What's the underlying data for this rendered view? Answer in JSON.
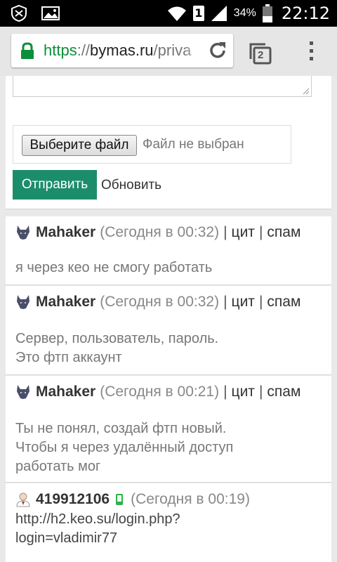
{
  "status_bar": {
    "sim_slot": "1",
    "battery_percent": "34%",
    "time": "22:12"
  },
  "browser": {
    "url_scheme": "https",
    "url_separator": "://",
    "url_host": "bymas.ru",
    "url_path": "/priva",
    "tab_count": "2"
  },
  "form": {
    "choose_file_label": "Выберите файл",
    "no_file_text": "Файл не выбран",
    "send_label": "Отправить",
    "refresh_label": "Обновить"
  },
  "posts": [
    {
      "author": "Mahaker",
      "date": "(Сегодня в 00:32)",
      "sep": "|",
      "quote": "цит",
      "spam": "спам",
      "lines": [
        "я через кео не смогу работать"
      ]
    },
    {
      "author": "Mahaker",
      "date": "(Сегодня в 00:32)",
      "sep": "|",
      "quote": "цит",
      "spam": "спам",
      "lines": [
        "Сервер, пользователь, пароль.",
        "Это фтп аккаунт"
      ]
    },
    {
      "author": "Mahaker",
      "date": "(Сегодня в 00:21)",
      "sep": "|",
      "quote": "цит",
      "spam": "спам",
      "lines": [
        "Ты не понял, создай фтп новый.",
        "Чтобы я через удалённый доступ",
        "работать мог"
      ]
    },
    {
      "author": "419912106",
      "date": "(Сегодня в 00:19)",
      "lines": [
        "http://h2.keo.su/login.php?",
        "login=vladimir77"
      ]
    }
  ],
  "colors": {
    "send_button": "#1c8d6a",
    "https_green": "#0b8f3a",
    "online_phone": "#2db34a"
  },
  "icons": [
    "shield-icon",
    "image-icon",
    "wifi-icon",
    "signal-icon",
    "battery-icon",
    "lock-icon",
    "reload-icon",
    "tabs-icon",
    "overflow-menu-icon",
    "wolf-avatar-icon",
    "user-avatar-icon",
    "mobile-phone-icon"
  ]
}
